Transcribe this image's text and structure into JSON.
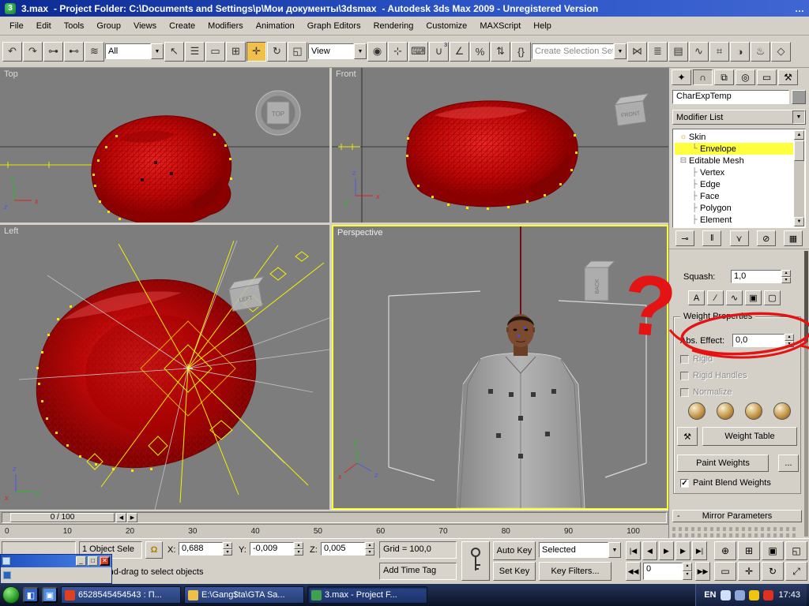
{
  "titlebar": {
    "doc": "3.max",
    "project": "- Project Folder: C:\\Documents and Settings\\p\\Мои документы\\3dsmax",
    "app": "- Autodesk 3ds Max  2009  - Unregistered Version",
    "overflow": "…"
  },
  "menubar": [
    "File",
    "Edit",
    "Tools",
    "Group",
    "Views",
    "Create",
    "Modifiers",
    "Animation",
    "Graph Editors",
    "Rendering",
    "Customize",
    "MAXScript",
    "Help"
  ],
  "toolbar": {
    "filter_value": "All",
    "coord_value": "View",
    "selection_set_placeholder": "Create Selection Set",
    "group_a": [
      {
        "name": "undo-icon",
        "glyph": "↶"
      },
      {
        "name": "redo-icon",
        "glyph": "↷"
      },
      {
        "name": "select-and-link-icon",
        "glyph": "⊶"
      },
      {
        "name": "unlink-selection-icon",
        "glyph": "⊷"
      },
      {
        "name": "bind-to-space-warp-icon",
        "glyph": "≋"
      }
    ],
    "group_b": [
      {
        "name": "select-object-icon",
        "glyph": "↖"
      },
      {
        "name": "select-by-name-icon",
        "glyph": "☰"
      },
      {
        "name": "rectangular-selection-region-icon",
        "glyph": "▭"
      },
      {
        "name": "window-crossing-icon",
        "glyph": "⊞"
      },
      {
        "name": "select-and-move-icon",
        "glyph": "✛",
        "active": true
      },
      {
        "name": "select-and-rotate-icon",
        "glyph": "↻"
      },
      {
        "name": "select-and-uniform-scale-icon",
        "glyph": "◱"
      }
    ],
    "group_c": [
      {
        "name": "use-pivot-point-center-icon",
        "glyph": "◉"
      },
      {
        "name": "select-and-manipulate-icon",
        "glyph": "⊹"
      },
      {
        "name": "keyboard-shortcut-override-icon",
        "glyph": "⌨"
      },
      {
        "name": "snaps-toggle-icon",
        "glyph": "∪",
        "badge": "3"
      },
      {
        "name": "angle-snap-toggle-icon",
        "glyph": "∠"
      },
      {
        "name": "percent-snap-toggle-icon",
        "glyph": "%"
      },
      {
        "name": "spinner-snap-toggle-icon",
        "glyph": "⇅"
      },
      {
        "name": "edit-named-selection-sets-icon",
        "glyph": "{}"
      }
    ],
    "group_d": [
      {
        "name": "mirror-icon",
        "glyph": "⋈"
      },
      {
        "name": "align-icon",
        "glyph": "≣"
      },
      {
        "name": "layer-manager-icon",
        "glyph": "▤"
      },
      {
        "name": "curve-editor-icon",
        "glyph": "∿"
      },
      {
        "name": "schematic-view-icon",
        "glyph": "⌗"
      },
      {
        "name": "material-editor-icon",
        "glyph": "◑"
      },
      {
        "name": "render-setup-icon",
        "glyph": "♨"
      },
      {
        "name": "quick-render-icon",
        "glyph": "◇"
      }
    ]
  },
  "viewports": {
    "top_label": "Top",
    "front_label": "Front",
    "left_label": "Left",
    "persp_label": "Perspective",
    "gizmo_top": "TOP",
    "gizmo_front": "FRONT",
    "gizmo_left": "LEFT",
    "gizmo_back": "BACK"
  },
  "command_panel": {
    "tabs": [
      {
        "name": "create-tab-icon",
        "glyph": "✦"
      },
      {
        "name": "modify-tab-icon",
        "glyph": "∩",
        "active": true
      },
      {
        "name": "hierarchy-tab-icon",
        "glyph": "⧉"
      },
      {
        "name": "motion-tab-icon",
        "glyph": "◎"
      },
      {
        "name": "display-tab-icon",
        "glyph": "▭"
      },
      {
        "name": "utilities-tab-icon",
        "glyph": "⚒"
      }
    ],
    "object_name": "CharExpTemp",
    "modifier_list_label": "Modifier List",
    "stack": [
      {
        "label": "Skin",
        "icon": "bulb",
        "indent": 0,
        "selected": false
      },
      {
        "label": "Envelope",
        "icon": "subtree",
        "indent": 1,
        "selected": true
      },
      {
        "label": "Editable Mesh",
        "icon": "collapse",
        "indent": 0,
        "selected": false
      },
      {
        "label": "Vertex",
        "icon": "tree",
        "indent": 1,
        "selected": false
      },
      {
        "label": "Edge",
        "icon": "tree",
        "indent": 1,
        "selected": false
      },
      {
        "label": "Face",
        "icon": "tree",
        "indent": 1,
        "selected": false
      },
      {
        "label": "Polygon",
        "icon": "tree",
        "indent": 1,
        "selected": false
      },
      {
        "label": "Element",
        "icon": "tree",
        "indent": 1,
        "selected": false
      }
    ],
    "stack_tools": [
      {
        "name": "pin-stack-icon",
        "glyph": "⊸"
      },
      {
        "name": "show-end-result-icon",
        "glyph": "‖"
      },
      {
        "name": "make-unique-icon",
        "glyph": "⋎"
      },
      {
        "name": "remove-modifier-icon",
        "glyph": "⊘"
      },
      {
        "name": "configure-modifier-sets-icon",
        "glyph": "▦"
      }
    ],
    "rollout": {
      "squash_label": "Squash:",
      "squash_value": "1,0",
      "edit_icons": [
        {
          "name": "letter-a-icon",
          "glyph": "A"
        },
        {
          "name": "falloff-icon",
          "glyph": "∕"
        },
        {
          "name": "curve-icon",
          "glyph": "∿"
        },
        {
          "name": "copy-icon",
          "glyph": "▣"
        },
        {
          "name": "paste-icon",
          "glyph": "▢"
        }
      ],
      "weight_group_title": "Weight Properties",
      "abs_effect_label": "Abs. Effect:",
      "abs_effect_value": "0,0",
      "checks": [
        {
          "label": "Rigid",
          "checked": false,
          "disabled": true
        },
        {
          "label": "Rigid Handles",
          "checked": false,
          "disabled": true
        },
        {
          "label": "Normalize",
          "checked": false,
          "disabled": true
        }
      ],
      "weight_tools": [
        {
          "name": "weight-tool-1-icon"
        },
        {
          "name": "weight-tool-2-icon"
        },
        {
          "name": "weight-tool-3-icon"
        },
        {
          "name": "weight-tool-4-icon"
        }
      ],
      "weight_table_label": "Weight Table",
      "paint_weights_label": "Paint Weights",
      "paint_options_label": "...",
      "paint_blend_label": "Paint Blend Weights",
      "paint_blend_checked": true,
      "mirror_collapse": "-",
      "mirror_title": "Mirror Parameters"
    }
  },
  "annotation": {
    "question_mark": "?"
  },
  "timeline": {
    "slider": "0 / 100",
    "ticks": [
      "0",
      "10",
      "20",
      "30",
      "40",
      "50",
      "60",
      "70",
      "80",
      "90",
      "100"
    ]
  },
  "statusbar": {
    "selection": "1 Object Sele",
    "lock_glyph": "Ω",
    "x_label": "X:",
    "x": "0,688",
    "y_label": "Y:",
    "y": "-0,009",
    "z_label": "Z:",
    "z": "0,005",
    "grid": "Grid = 100,0",
    "prompt": "Click-and-drag to select objects",
    "time_tag": "Add Time Tag"
  },
  "anim": {
    "auto_key": "Auto Key",
    "set_key": "Set Key",
    "selected_filter": "Selected",
    "key_filters": "Key Filters...",
    "frame": "0",
    "prev_key_glyph": "◀◀",
    "next_key_glyph": "▶▶",
    "playback": [
      {
        "name": "go-to-start-icon",
        "glyph": "|◀"
      },
      {
        "name": "previous-frame-icon",
        "glyph": "◀"
      },
      {
        "name": "play-animation-icon",
        "glyph": "▶",
        "big": true
      },
      {
        "name": "next-frame-icon",
        "glyph": "▶"
      },
      {
        "name": "go-to-end-icon",
        "glyph": "▶|"
      }
    ],
    "nav_icons": [
      {
        "name": "zoom-icon",
        "glyph": "⊕"
      },
      {
        "name": "zoom-all-icon",
        "glyph": "⊞"
      },
      {
        "name": "zoom-extents-icon",
        "glyph": "▣"
      },
      {
        "name": "zoom-extents-all-icon",
        "glyph": "◱"
      },
      {
        "name": "zoom-region-icon",
        "glyph": "▭"
      },
      {
        "name": "pan-view-icon",
        "glyph": "✛"
      },
      {
        "name": "arc-rotate-icon",
        "glyph": "↻"
      },
      {
        "name": "maximize-viewport-toggle-icon",
        "glyph": "⤢"
      }
    ]
  },
  "taskbar": {
    "tasks": [
      {
        "label": "6528545454543 : П...",
        "icon": "chat",
        "active": false
      },
      {
        "label": "E:\\Gang$ta\\GTA Sa...",
        "icon": "folder",
        "active": false
      },
      {
        "label": "3.max     - Project F...",
        "icon": "max",
        "active": true
      }
    ],
    "tray_icons": [
      {
        "name": "network-tray-icon",
        "color": "#cfe0f8"
      },
      {
        "name": "volume-tray-icon",
        "color": "#8fa8d8"
      },
      {
        "name": "antivirus-tray-icon",
        "color": "#f2c30f"
      },
      {
        "name": "guard-tray-icon",
        "color": "#e03020"
      }
    ],
    "lang": "EN",
    "clock": "17:43"
  }
}
